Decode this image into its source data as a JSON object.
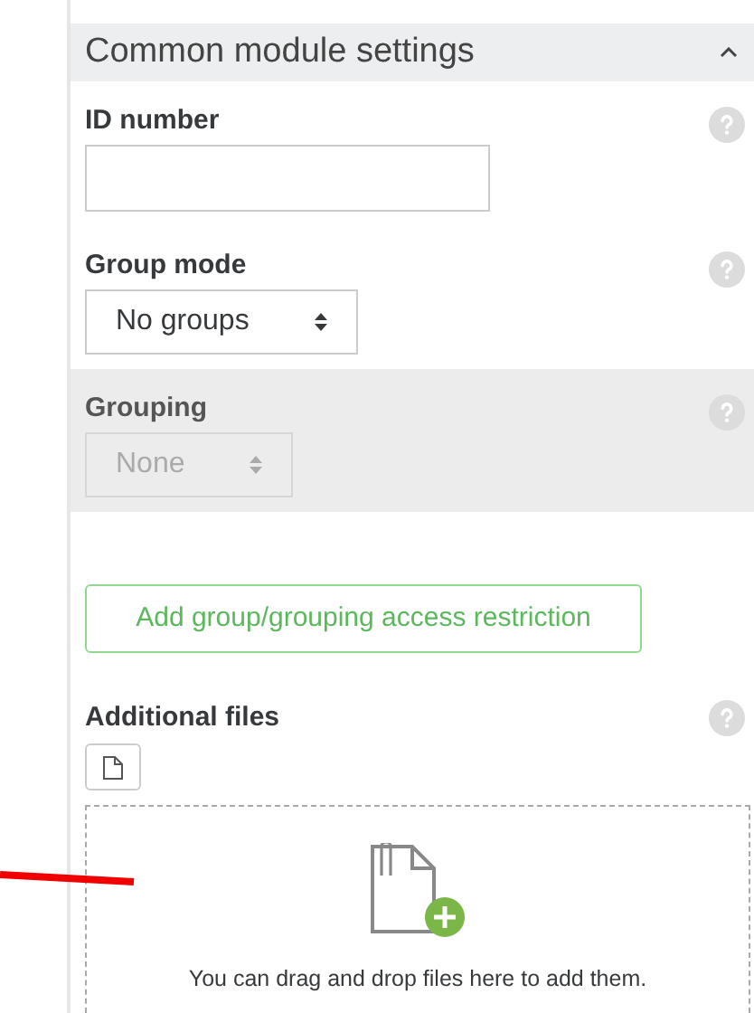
{
  "section": {
    "title": "Common module settings",
    "expanded": true
  },
  "fields": [
    {
      "kind": "text",
      "label": "ID number",
      "disabled": false
    },
    {
      "kind": "select",
      "label": "Group mode",
      "value": "No groups",
      "disabled": false
    },
    {
      "kind": "select",
      "label": "Grouping",
      "value": "None",
      "disabled": true
    }
  ],
  "restriction_button": "Add group/grouping access restriction",
  "files": {
    "label": "Additional files",
    "dropzone_text": "You can drag and drop files here to add them."
  }
}
